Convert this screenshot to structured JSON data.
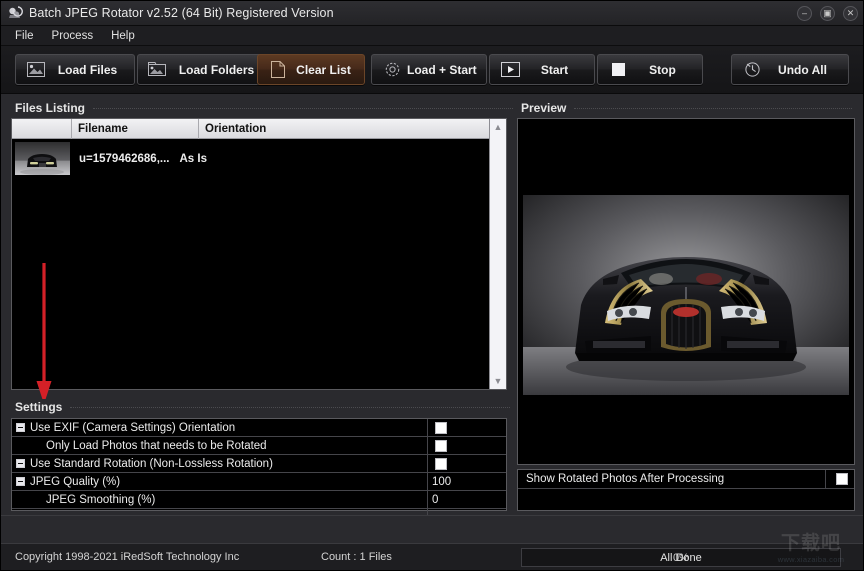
{
  "window": {
    "title": "Batch JPEG Rotator v2.52 (64 Bit) Registered Version",
    "app_icon": "rotator-icon",
    "controls": {
      "minimize": "–",
      "maximize": "▣",
      "close": "✕"
    }
  },
  "menu": {
    "items": [
      {
        "label": "File"
      },
      {
        "label": "Process"
      },
      {
        "label": "Help"
      }
    ]
  },
  "toolbar": {
    "buttons": [
      {
        "label": "Load Files",
        "icon": "image-file-icon",
        "state": "normal"
      },
      {
        "label": "Load Folders",
        "icon": "image-folder-icon",
        "state": "normal"
      },
      {
        "label": "Clear List",
        "icon": "blank-page-icon",
        "state": "highlighted"
      },
      {
        "label": "Load + Start",
        "icon": "gear-icon",
        "state": "normal"
      },
      {
        "label": "Start",
        "icon": "play-icon",
        "state": "normal"
      },
      {
        "label": "Stop",
        "icon": "stop-icon",
        "state": "normal"
      },
      {
        "label": "Undo All",
        "icon": "clock-undo-icon",
        "state": "normal"
      }
    ]
  },
  "files_panel": {
    "header": "Files Listing",
    "columns": [
      "",
      "Filename",
      "Orientation"
    ],
    "rows": [
      {
        "thumbnail": "car-thumbnail",
        "filename": "u=1579462686,...",
        "orientation": "As Is"
      }
    ],
    "scrollbar": {
      "up": "ⱏ",
      "down": "ⱞ"
    }
  },
  "settings_panel": {
    "header": "Settings",
    "rows": [
      {
        "label": "Use EXIF (Camera Settings) Orientation",
        "expander": true,
        "indent": false,
        "control": "checkbox",
        "value": ""
      },
      {
        "label": "Only Load Photos that needs to be Rotated",
        "expander": false,
        "indent": true,
        "control": "checkbox",
        "value": ""
      },
      {
        "label": "Use Standard Rotation (Non-Lossless Rotation)",
        "expander": true,
        "indent": false,
        "control": "checkbox",
        "value": ""
      },
      {
        "label": "JPEG Quality (%)",
        "expander": true,
        "indent": false,
        "control": "text",
        "value": "100"
      },
      {
        "label": "JPEG Smoothing (%)",
        "expander": false,
        "indent": true,
        "control": "text",
        "value": "0"
      }
    ]
  },
  "preview_panel": {
    "header": "Preview",
    "image": "bugatti-veyron-front-photo"
  },
  "options_panel": {
    "rows": [
      {
        "label": "Show Rotated Photos After Processing",
        "control": "checkbox"
      }
    ]
  },
  "statusbar": {
    "copyright": "Copyright 1998-2021 iRedSoft Technology Inc",
    "count": "Count : 1 Files",
    "progress_label": "All Done",
    "progress_percent": "0%"
  },
  "annotation": {
    "arrow": "red-down-arrow",
    "arrow_color": "#d42027"
  },
  "watermark": {
    "line1": "下载吧",
    "line2": "www.xiazaiba.com"
  }
}
